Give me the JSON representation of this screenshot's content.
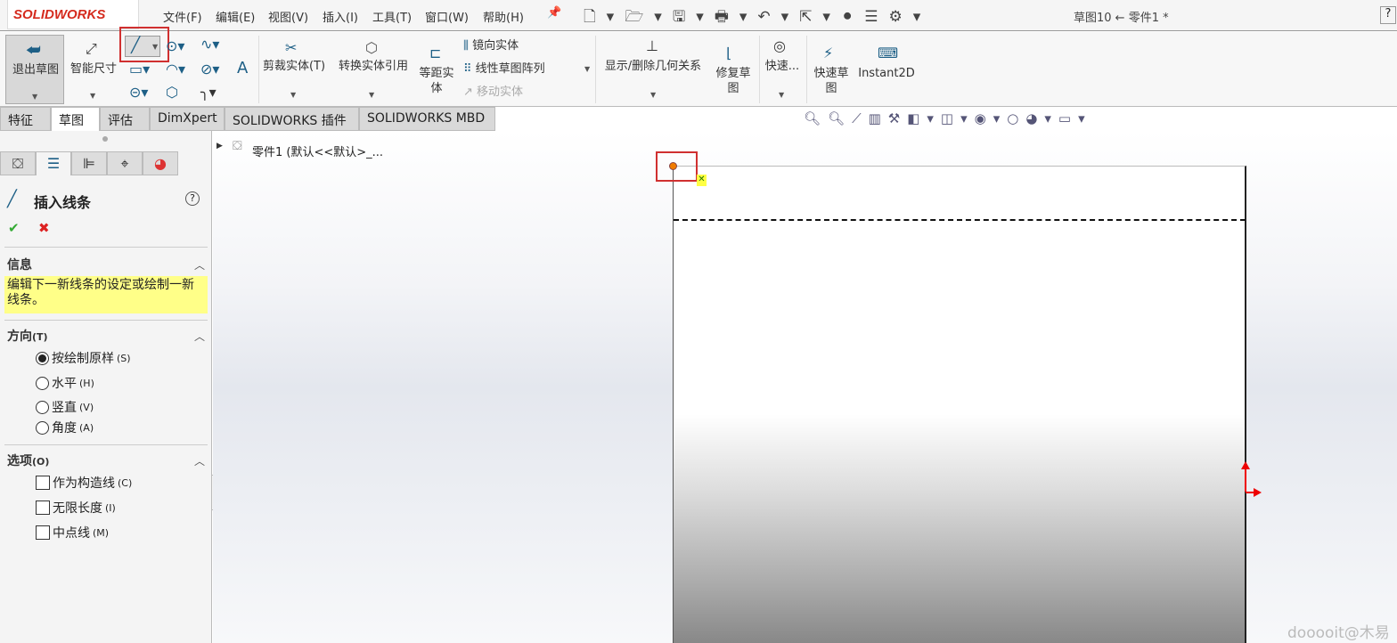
{
  "app": {
    "logo": "SOLIDWORKS",
    "title": "草图10 ← 零件1 *"
  },
  "menu": [
    "文件(F)",
    "编辑(E)",
    "视图(V)",
    "插入(I)",
    "工具(T)",
    "窗口(W)",
    "帮助(H)"
  ],
  "ribbon": {
    "exit_sketch": "退出草图",
    "smart_dim": "智能尺寸",
    "trim": "剪裁实体(T)",
    "convert": "转换实体引用",
    "offset": "等距实体",
    "mirror": "镜向实体",
    "linear_pattern": "线性草图阵列",
    "move": "移动实体",
    "relations": "显示/删除几何关系",
    "repair": "修复草图",
    "quick_snaps": "快速...",
    "rapid_sketch": "快速草图",
    "instant2d": "Instant2D"
  },
  "tabs": [
    "特征",
    "草图",
    "评估",
    "DimXpert",
    "SOLIDWORKS 插件",
    "SOLIDWORKS MBD"
  ],
  "active_tab": "草图",
  "panel": {
    "title": "插入线条",
    "info_header": "信息",
    "info_text": "编辑下一新线条的设定或绘制一新线条。",
    "direction_header": "方向",
    "direction_key": "(T)",
    "directions": [
      {
        "label": "按绘制原样",
        "key": "(S)",
        "selected": true
      },
      {
        "label": "水平",
        "key": "(H)",
        "selected": false
      },
      {
        "label": "竖直",
        "key": "(V)",
        "selected": false
      },
      {
        "label": "角度",
        "key": "(A)",
        "selected": false
      }
    ],
    "options_header": "选项",
    "options_key": "(O)",
    "options": [
      {
        "label": "作为构造线",
        "key": "(C)",
        "checked": false
      },
      {
        "label": "无限长度",
        "key": "(I)",
        "checked": false
      },
      {
        "label": "中点线",
        "key": "(M)",
        "checked": false
      }
    ]
  },
  "tree": {
    "root": "零件1  (默认<<默认>_..."
  },
  "watermark": "dooooit@木易",
  "colors": {
    "accent": "#d52b1e",
    "highlight": "#ffff88",
    "point": "#f07c00"
  }
}
